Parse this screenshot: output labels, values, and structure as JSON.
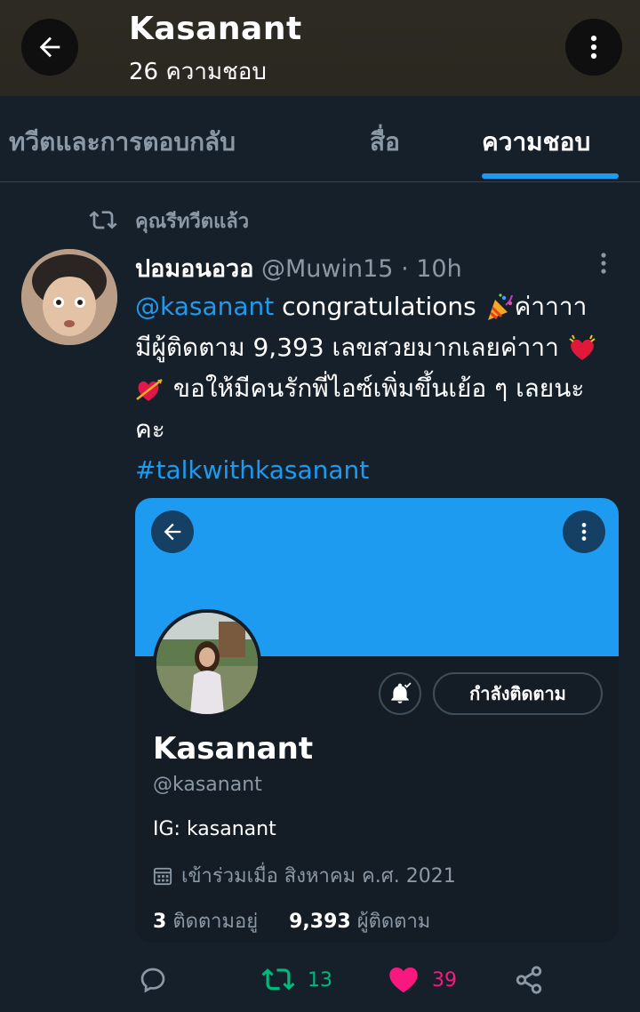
{
  "header": {
    "title": "Kasanant",
    "subtitle": "26 ความชอบ",
    "back_icon": "arrow-left-icon",
    "more_icon": "more-vertical-icon"
  },
  "tabs": [
    {
      "label": "ทวีตและการตอบกลับ",
      "active": false
    },
    {
      "label": "สื่อ",
      "active": false
    },
    {
      "label": "ความชอบ",
      "active": true
    }
  ],
  "tweet": {
    "retweet_label": "คุณรีทวีตแล้ว",
    "author_name": "ปอมอนอวอ",
    "author_handle": "@Muwin15",
    "separator": " · ",
    "time": "10h",
    "mention": "@kasanant",
    "text_1": " congratulations ",
    "text_2": "ค่าาาา มีผู้ติดตาม  9,393 เลขสวยมากเลยค่าาา ",
    "text_3": " ขอให้มีคนรักพี่ไอซ์เพิ่มขึ้นเย้อ ๆ เลยนะคะ",
    "hashtag": "#talkwithkasanant",
    "retweet_count": "13",
    "like_count": "39"
  },
  "embed": {
    "name": "Kasanant",
    "handle": "@kasanant",
    "bio": "IG: kasanant",
    "joined": "เข้าร่วมเมื่อ สิงหาคม ค.ศ. 2021",
    "following_count": "3",
    "following_label": "ติดตามอยู่",
    "followers_count": "9,393",
    "followers_label": "ผู้ติดตาม",
    "follow_button": "กำลังติดตาม"
  },
  "colors": {
    "accent": "#1d9bf0",
    "retweet_green": "#00ba7c",
    "like_pink": "#f91880",
    "background": "#15202b"
  }
}
